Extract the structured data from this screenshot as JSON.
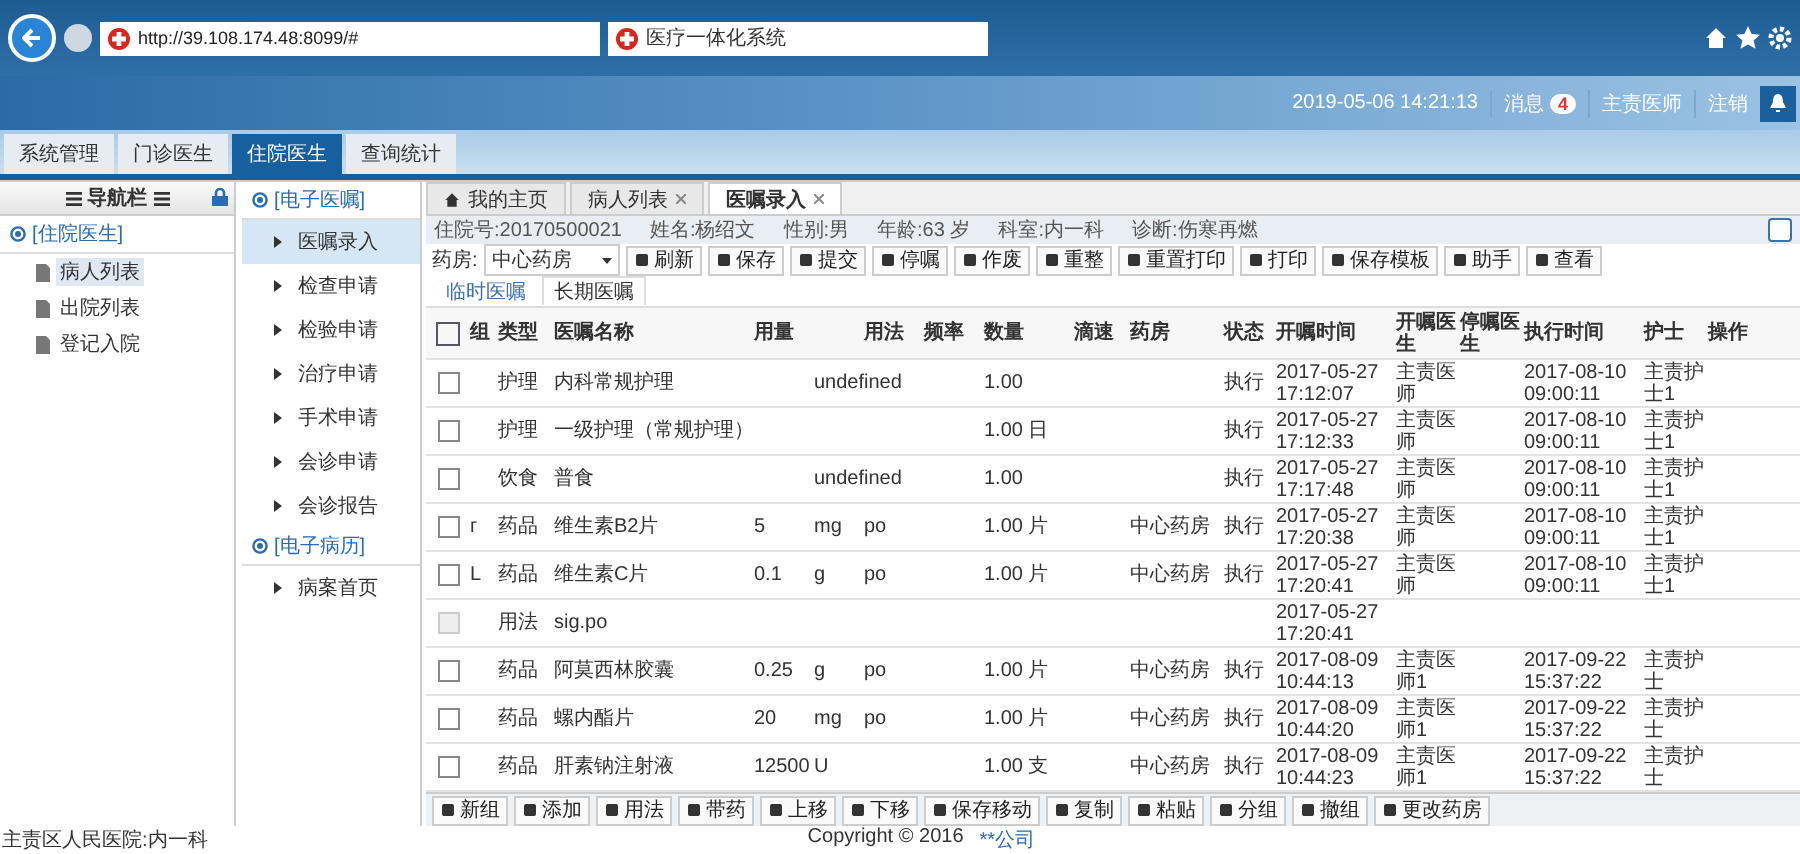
{
  "browser": {
    "url": "http://39.108.174.48:8099/#",
    "tab_title": "医疗一体化系统"
  },
  "header": {
    "datetime": "2019-05-06 14:21:13",
    "messages_label": "消息",
    "messages_count": "4",
    "user": "主责医师",
    "logout": "注销"
  },
  "main_tabs": [
    {
      "label": "系统管理",
      "selected": false
    },
    {
      "label": "门诊医生",
      "selected": false
    },
    {
      "label": "住院医生",
      "selected": true
    },
    {
      "label": "查询统计",
      "selected": false
    }
  ],
  "nav": {
    "title": "导航栏",
    "section": "[住院医生]",
    "items": [
      {
        "label": "病人列表",
        "selected": true
      },
      {
        "label": "出院列表",
        "selected": false
      },
      {
        "label": "登记入院",
        "selected": false
      }
    ]
  },
  "menu": [
    {
      "title": "[电子医嘱]",
      "items": [
        {
          "label": "医嘱录入",
          "selected": true
        },
        {
          "label": "检查申请",
          "selected": false
        },
        {
          "label": "检验申请",
          "selected": false
        },
        {
          "label": "治疗申请",
          "selected": false
        },
        {
          "label": "手术申请",
          "selected": false
        },
        {
          "label": "会诊申请",
          "selected": false
        },
        {
          "label": "会诊报告",
          "selected": false
        }
      ]
    },
    {
      "title": "[电子病历]",
      "items": [
        {
          "label": "病案首页",
          "selected": false
        }
      ]
    }
  ],
  "page_tabs": [
    {
      "label": "我的主页",
      "kind": "home",
      "selected": false
    },
    {
      "label": "病人列表",
      "kind": "closable",
      "selected": false
    },
    {
      "label": "医嘱录入",
      "kind": "closable",
      "selected": true
    }
  ],
  "patient": {
    "fields": [
      "住院号:20170500021",
      "姓名:杨绍文",
      "性别:男",
      "年龄:63 岁",
      "科室:内一科",
      "诊断:伤寒再燃"
    ],
    "toggle_checked": false
  },
  "toolbar": {
    "pharmacy_label": "药房:",
    "pharmacy": "中心药房",
    "buttons": [
      "刷新",
      "保存",
      "提交",
      "停嘱",
      "作废",
      "重整",
      "重置打印",
      "打印",
      "保存模板",
      "助手",
      "查看"
    ]
  },
  "order_tabs": [
    {
      "label": "临时医嘱",
      "selected": false
    },
    {
      "label": "长期医嘱",
      "selected": true
    }
  ],
  "table": {
    "select_all_checked": false,
    "columns": [
      "组",
      "类型",
      "医嘱名称",
      "用量",
      "用法",
      "频率",
      "数量",
      "滴速",
      "药房",
      "状态",
      "开嘱时间",
      "开嘱医生",
      "停嘱医生",
      "执行时间",
      "护士",
      "操作"
    ],
    "rows": [
      {
        "disabled": false,
        "type": "护理",
        "name": "内科常规护理",
        "unit": "undefined",
        "qty": "1.00",
        "status": "执行",
        "start": "2017-05-27 17:12:07",
        "doctor": "主责医师",
        "exec": "2017-08-10 09:00:11",
        "nurse": "主责护士1"
      },
      {
        "disabled": false,
        "type": "护理",
        "name": "一级护理（常规护理）",
        "qty": "1.00 日",
        "status": "执行",
        "start": "2017-05-27 17:12:33",
        "doctor": "主责医师",
        "exec": "2017-08-10 09:00:11",
        "nurse": "主责护士1"
      },
      {
        "disabled": false,
        "type": "饮食",
        "name": "普食",
        "unit": "undefined",
        "qty": "1.00",
        "status": "执行",
        "start": "2017-05-27 17:17:48",
        "doctor": "主责医师",
        "exec": "2017-08-10 09:00:11",
        "nurse": "主责护士1"
      },
      {
        "disabled": false,
        "group": "г",
        "type": "药品",
        "name": "维生素B2片",
        "dose": "5",
        "unit": "mg",
        "usage": "po",
        "qty": "1.00 片",
        "pharmacy": "中心药房",
        "status": "执行",
        "start": "2017-05-27 17:20:38",
        "doctor": "主责医师",
        "exec": "2017-08-10 09:00:11",
        "nurse": "主责护士1"
      },
      {
        "disabled": false,
        "group": "L",
        "type": "药品",
        "name": "维生素C片",
        "dose": "0.1",
        "unit": "g",
        "usage": "po",
        "qty": "1.00 片",
        "pharmacy": "中心药房",
        "status": "执行",
        "start": "2017-05-27 17:20:41",
        "doctor": "主责医师",
        "exec": "2017-08-10 09:00:11",
        "nurse": "主责护士1"
      },
      {
        "disabled": true,
        "type": "用法",
        "name": "sig.po",
        "start": "2017-05-27 17:20:41"
      },
      {
        "disabled": false,
        "type": "药品",
        "name": "阿莫西林胶囊",
        "dose": "0.25",
        "unit": "g",
        "usage": "po",
        "qty": "1.00 片",
        "pharmacy": "中心药房",
        "status": "执行",
        "start": "2017-08-09 10:44:13",
        "doctor": "主责医师1",
        "exec": "2017-09-22 15:37:22",
        "nurse": "主责护士"
      },
      {
        "disabled": false,
        "type": "药品",
        "name": "螺内酯片",
        "dose": "20",
        "unit": "mg",
        "usage": "po",
        "qty": "1.00 片",
        "pharmacy": "中心药房",
        "status": "执行",
        "start": "2017-08-09 10:44:20",
        "doctor": "主责医师1",
        "exec": "2017-09-22 15:37:22",
        "nurse": "主责护士"
      },
      {
        "disabled": false,
        "type": "药品",
        "name": "肝素钠注射液",
        "dose": "12500",
        "unit": "U",
        "qty": "1.00 支",
        "pharmacy": "中心药房",
        "status": "执行",
        "start": "2017-08-09 10:44:23",
        "doctor": "主责医师1",
        "exec": "2017-09-22 15:37:22",
        "nurse": "主责护士"
      }
    ]
  },
  "bottom_buttons": [
    "新组",
    "添加",
    "用法",
    "带药",
    "上移",
    "下移",
    "保存移动",
    "复制",
    "粘贴",
    "分组",
    "撤组",
    "更改药房"
  ],
  "footer": {
    "left": "主责区人民医院:内一科",
    "copyright": "Copyright © 2016",
    "company": "**公司"
  }
}
